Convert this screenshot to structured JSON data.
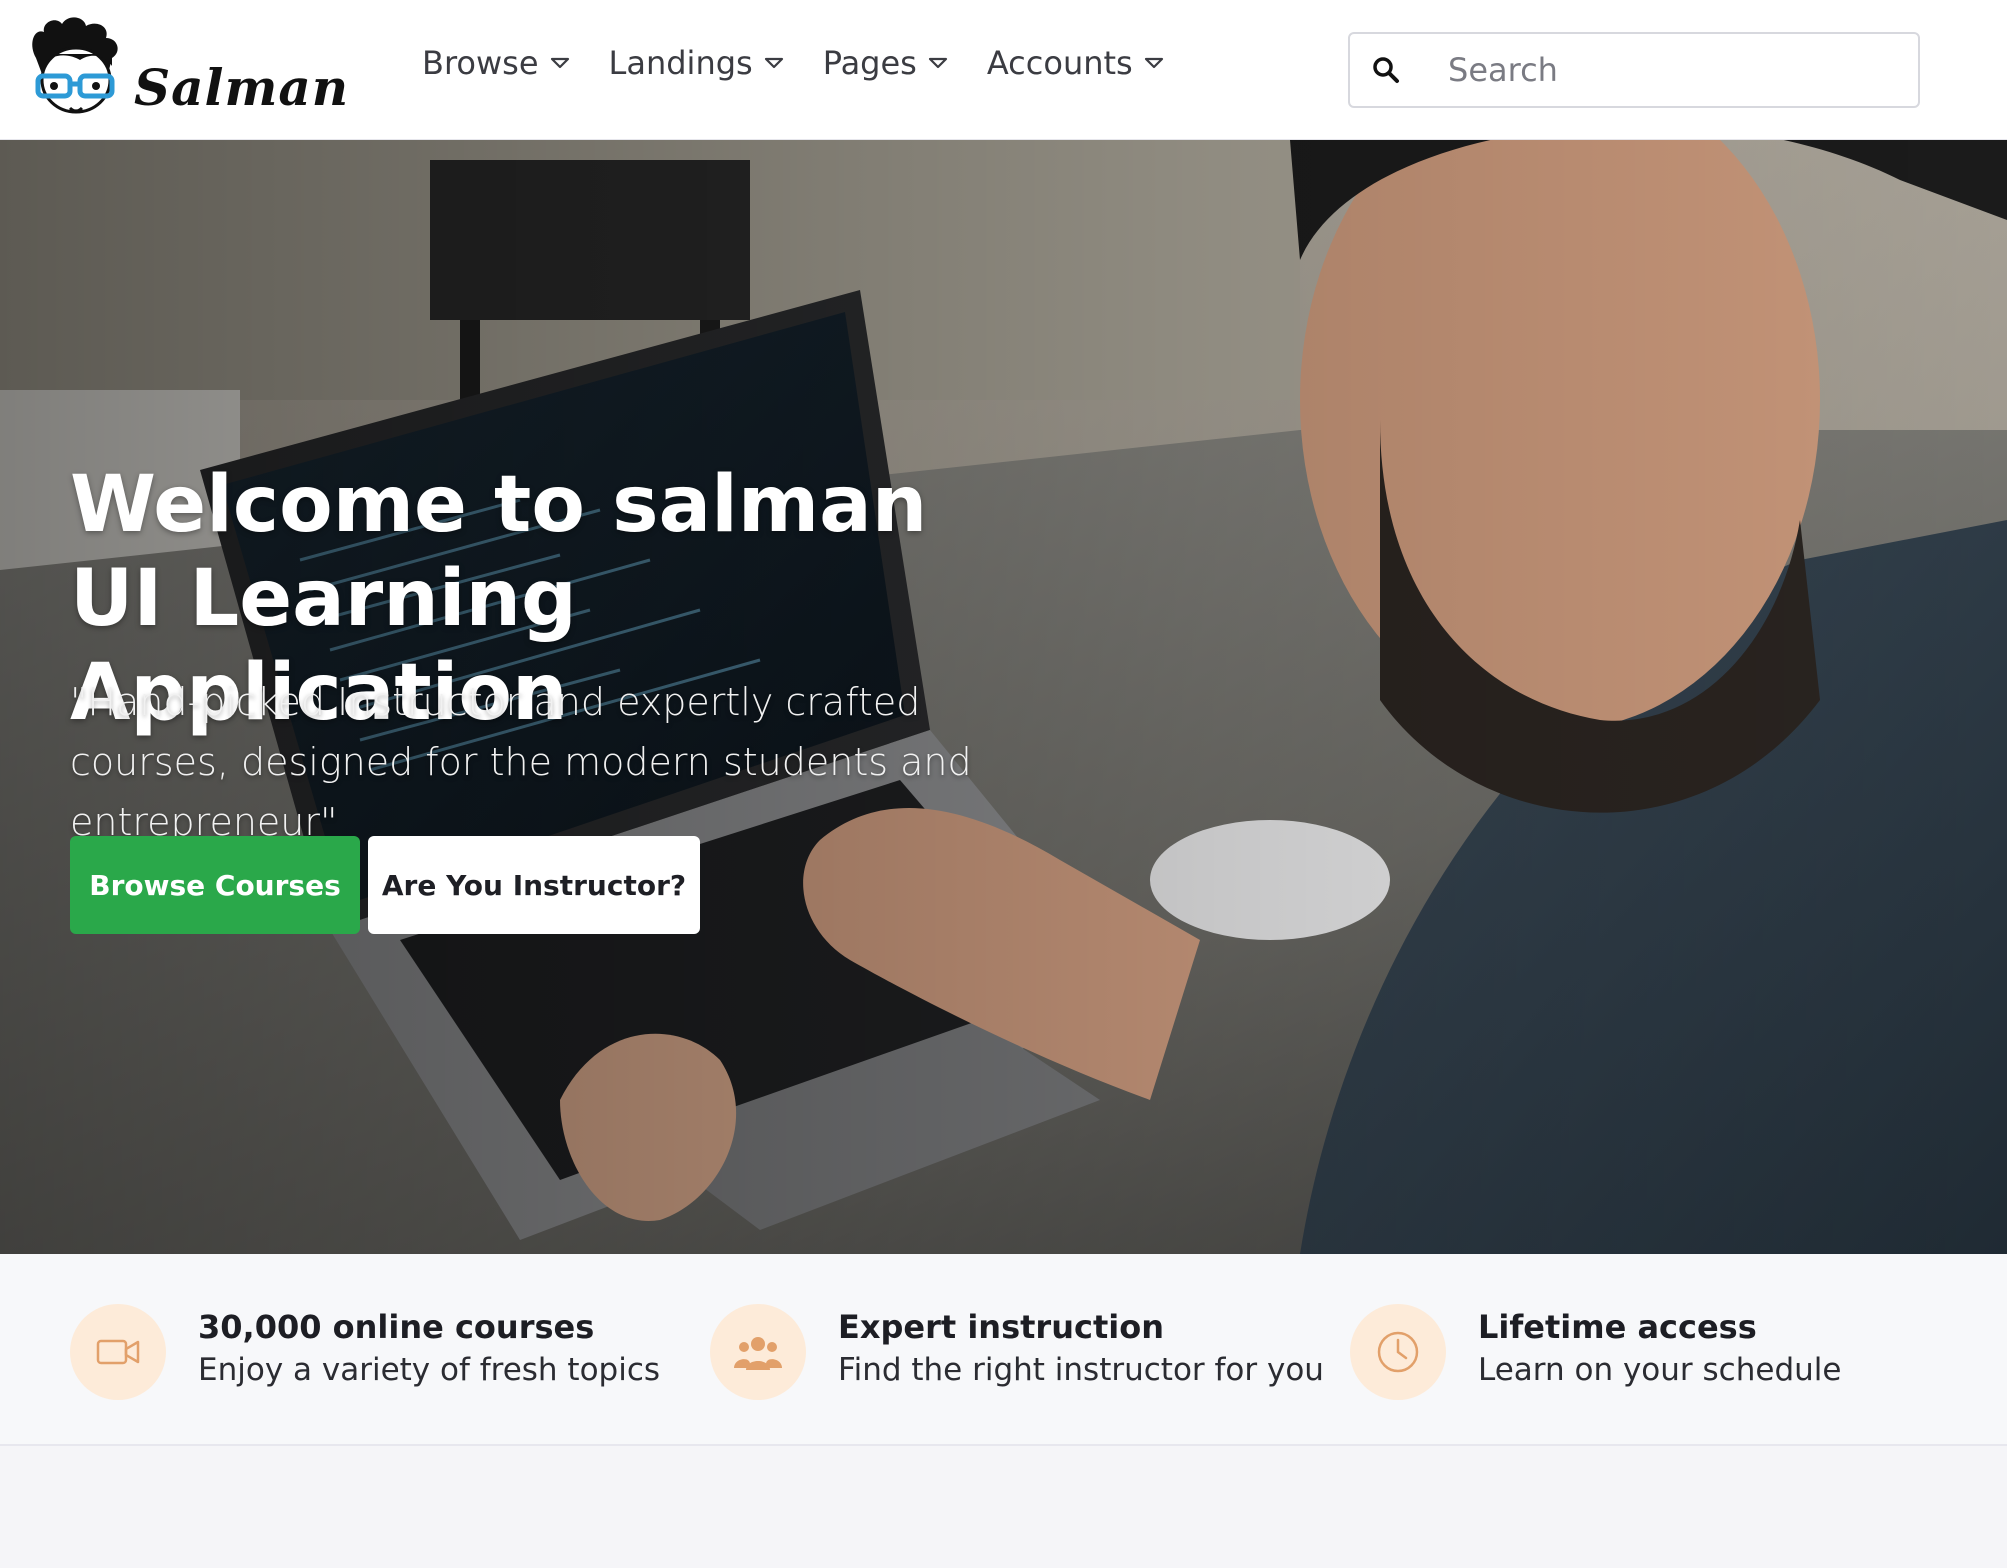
{
  "header": {
    "logo_text": "Salman",
    "nav": [
      {
        "label": "Browse"
      },
      {
        "label": "Landings"
      },
      {
        "label": "Pages"
      },
      {
        "label": "Accounts"
      }
    ],
    "search": {
      "placeholder": "Search",
      "value": ""
    }
  },
  "hero": {
    "title": "Welcome to salman UI Learning Application",
    "subtitle": "\"Hand-picked Instructor and expertly crafted courses, designed for the modern students and entrepreneur\"",
    "primary_button": "Browse Courses",
    "secondary_button": "Are You Instructor?"
  },
  "features": [
    {
      "icon": "video-icon",
      "title": "30,000 online courses",
      "desc": "Enjoy a variety of fresh topics"
    },
    {
      "icon": "users-icon",
      "title": "Expert instruction",
      "desc": "Find the right instructor for you"
    },
    {
      "icon": "clock-icon",
      "title": "Lifetime access",
      "desc": "Learn on your schedule"
    }
  ],
  "colors": {
    "primary": "#2aa84a",
    "feature_icon_bg": "#fdebd9",
    "feature_icon_fg": "#e2a06a"
  }
}
